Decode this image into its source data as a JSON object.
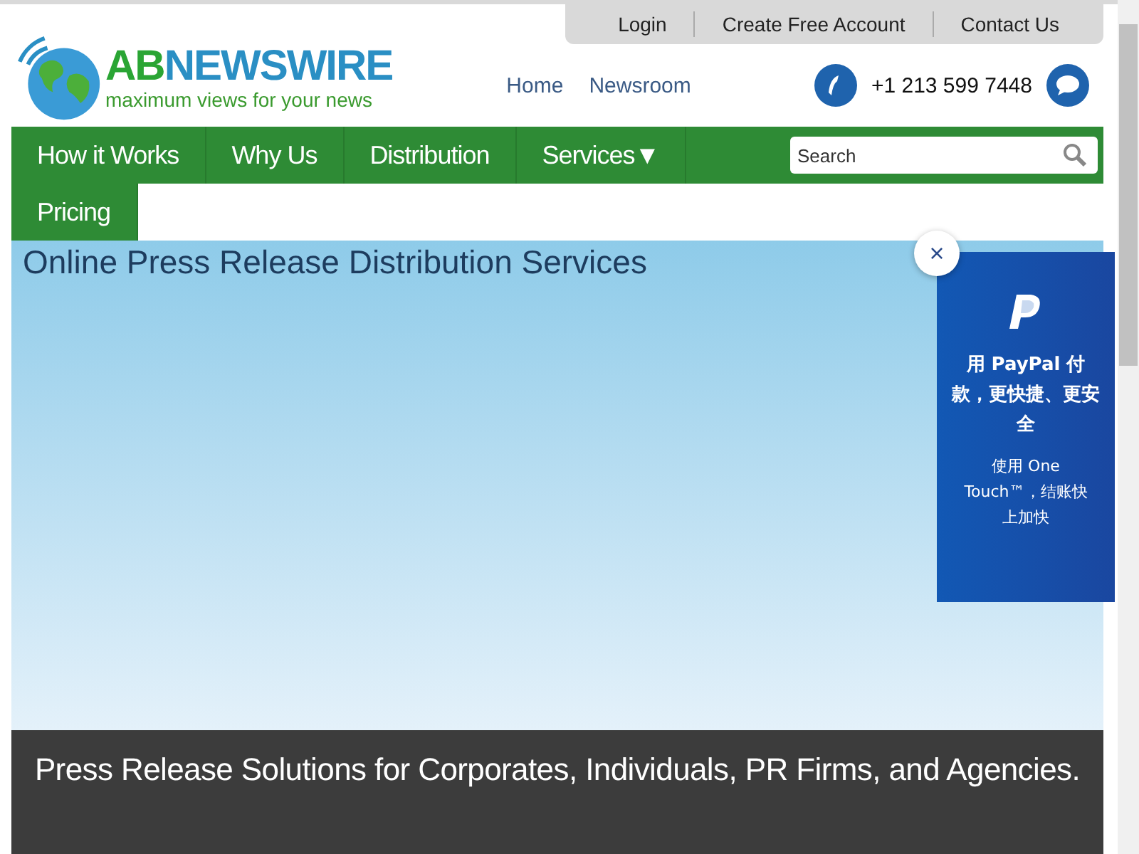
{
  "top_links": [
    "Login",
    "Create Free Account",
    "Contact Us"
  ],
  "logo": {
    "name_part_1": "AB",
    "name_part_2": "NEWSWIRE",
    "tagline": "maximum views for your news"
  },
  "header_links": [
    "Home",
    "Newsroom"
  ],
  "phone": "+1 213 599 7448",
  "nav": [
    {
      "label": "How it Works",
      "dropdown": false
    },
    {
      "label": "Why Us",
      "dropdown": false
    },
    {
      "label": "Distribution",
      "dropdown": false
    },
    {
      "label": "Services",
      "dropdown": true
    },
    {
      "label": "Pricing",
      "dropdown": false
    }
  ],
  "nav_dropdown_mark": "▼",
  "search": {
    "placeholder": "Search"
  },
  "hero": {
    "title": "Online Press Release Distribution Services"
  },
  "paypal_popup": {
    "close": "×",
    "headline": "用 PayPal 付款，更快捷、更安全",
    "body": "使用 One Touch™，结账快上加快"
  },
  "banner": {
    "text": "Press Release Solutions for Corporates, Individuals, PR Firms, and Agencies."
  }
}
